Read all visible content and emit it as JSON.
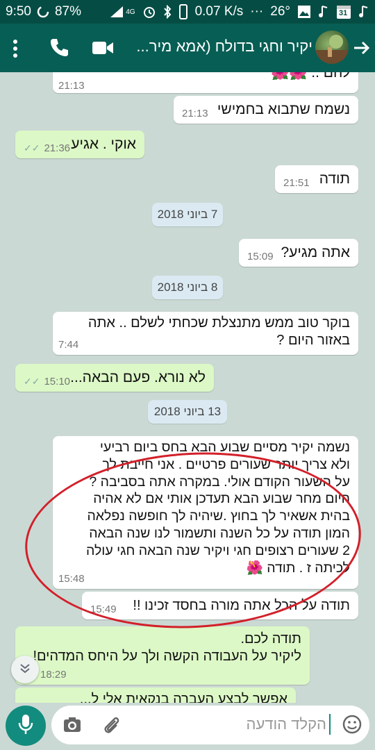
{
  "status_bar": {
    "time": "9:50",
    "battery": "87%",
    "network": "4G",
    "speed": "0.07 K/s",
    "temperature": "26°",
    "calendar_day": "31",
    "more": "···"
  },
  "header": {
    "contact_name": "יקיר וחגי בדולח (אמא מיר...",
    "icons": [
      "back-arrow-icon",
      "avatar",
      "video-call-icon",
      "phone-icon",
      "more-vert-icon"
    ]
  },
  "messages": [
    {
      "dir": "in",
      "text": "להם .. 🌺🌺",
      "time": "21:13"
    },
    {
      "dir": "in",
      "text": "נשמח שתבוא בחמישי",
      "time": "21:13"
    },
    {
      "dir": "out",
      "text": "אוקי . אגיע",
      "time": "21:36",
      "status": "read"
    },
    {
      "dir": "in",
      "text": "תודה",
      "time": "21:51"
    },
    {
      "date": "7 ביוני 2018"
    },
    {
      "dir": "in",
      "text": "אתה מגיע?",
      "time": "15:09"
    },
    {
      "date": "8 ביוני 2018"
    },
    {
      "dir": "in",
      "lines": [
        "בוקר טוב ממש מתנצלת שכחתי לשלם .. אתה",
        "באזור היום ?"
      ],
      "time": "7:44"
    },
    {
      "dir": "out",
      "text": "לא נורא. פעם הבאה...",
      "time": "15:10",
      "status": "read"
    },
    {
      "date": "13 ביוני 2018"
    },
    {
      "dir": "in",
      "lines": [
        "נשמה יקיר מסיים שבוע הבא בחס ביום רביעי",
        "ולא צריך יותר שעורים פרטיים . אני חייבת לך",
        "על השעור הקודם אולי. במקרה אתה בסביבה ?",
        "היום מחר שבוע הבא תעדכן אותי אם לא אהיה",
        "בהית אשאיר לך בחוץ .שיהיה לך חופשה נפלאה",
        "המון תודה על כל השנה ותשמור לנו שנה הבאה",
        "2 שעורים רצופים חגי ויקיר שנה הבאה חגי עולה",
        "לכיתה ז . תודה 🌺"
      ],
      "time": "15:48"
    },
    {
      "dir": "in",
      "text": "תודה על הכל אתה מורה בחסד זכינו !!",
      "time": "15:49"
    },
    {
      "dir": "out",
      "lines": [
        "תודה לכם.",
        "ליקיר על העבודה הקשה ולך על היחס המדהים!"
      ],
      "time": "18:29"
    },
    {
      "dir": "out",
      "text": "אפשר לבצע העברה בנקאית אלי ל...",
      "time": ""
    }
  ],
  "composer": {
    "placeholder": "הקלד הודעה",
    "icons": [
      "mic-icon",
      "camera-icon",
      "attach-icon",
      "emoji-icon"
    ]
  },
  "colors": {
    "header": "#075e54",
    "status_bar": "#054d44",
    "outgoing_bubble": "#dcf8c6",
    "incoming_bubble": "#ffffff",
    "annotation_circle": "#d2202a"
  }
}
